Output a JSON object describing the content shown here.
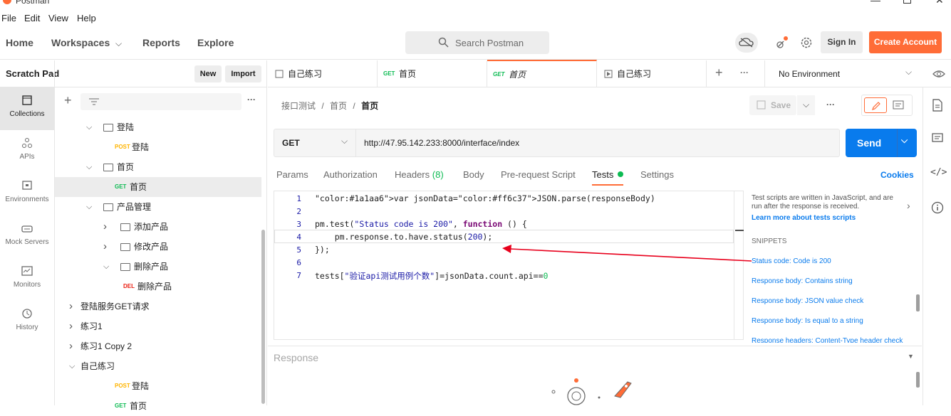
{
  "app": {
    "title": "Postman"
  },
  "menu": [
    "File",
    "Edit",
    "View",
    "Help"
  ],
  "nav": {
    "home": "Home",
    "workspaces": "Workspaces",
    "reports": "Reports",
    "explore": "Explore"
  },
  "search": {
    "placeholder": "Search Postman"
  },
  "account": {
    "signin": "Sign In",
    "create": "Create Account"
  },
  "sidebar": {
    "title": "Scratch Pad",
    "new": "New",
    "import": "Import"
  },
  "leftnav": [
    {
      "label": "Collections",
      "icon": "collections-icon"
    },
    {
      "label": "APIs",
      "icon": "apis-icon"
    },
    {
      "label": "Environments",
      "icon": "environments-icon"
    },
    {
      "label": "Mock Servers",
      "icon": "mock-servers-icon"
    },
    {
      "label": "Monitors",
      "icon": "monitors-icon"
    },
    {
      "label": "History",
      "icon": "history-icon"
    }
  ],
  "tree": [
    {
      "kind": "folder",
      "open": true,
      "label": "登陆",
      "level": 1
    },
    {
      "kind": "request",
      "method": "POST",
      "label": "登陆",
      "level": 2
    },
    {
      "kind": "folder",
      "open": true,
      "label": "首页",
      "level": 1
    },
    {
      "kind": "request",
      "method": "GET",
      "label": "首页",
      "level": 2,
      "selected": true
    },
    {
      "kind": "folder",
      "open": true,
      "label": "产品管理",
      "level": 1
    },
    {
      "kind": "folder",
      "open": false,
      "label": "添加产品",
      "level": 2
    },
    {
      "kind": "folder",
      "open": false,
      "label": "修改产品",
      "level": 2
    },
    {
      "kind": "folder",
      "open": true,
      "label": "删除产品",
      "level": 2
    },
    {
      "kind": "request",
      "method": "DEL",
      "label": "删除产品",
      "level": 3
    },
    {
      "kind": "collection",
      "open": false,
      "label": "登陆服务GET请求",
      "level": 0
    },
    {
      "kind": "collection",
      "open": false,
      "label": "练习1",
      "level": 0
    },
    {
      "kind": "collection",
      "open": false,
      "label": "练习1 Copy 2",
      "level": 0
    },
    {
      "kind": "collection",
      "open": true,
      "label": "自己练习",
      "level": 0
    },
    {
      "kind": "request",
      "method": "POST",
      "label": "登陆",
      "level": 2
    },
    {
      "kind": "request",
      "method": "GET",
      "label": "首页",
      "level": 2
    }
  ],
  "tabs": [
    {
      "label": "自己练习",
      "method": ""
    },
    {
      "label": "首页",
      "method": "GET"
    },
    {
      "label": "首页",
      "method": "GET",
      "active": true
    },
    {
      "label": "自己练习",
      "method": "",
      "runner": true
    }
  ],
  "environment": {
    "label": "No Environment"
  },
  "breadcrumb": {
    "p1": "接口测试",
    "sep": "/",
    "p2": "首页",
    "p3": "首页"
  },
  "toolbar": {
    "save": "Save"
  },
  "request": {
    "method": "GET",
    "url": "http://47.95.142.233:8000/interface/index",
    "send": "Send"
  },
  "reqtabs": {
    "params": "Params",
    "auth": "Authorization",
    "headers": "Headers",
    "headers_count": "(8)",
    "body": "Body",
    "prereq": "Pre-request Script",
    "tests": "Tests",
    "settings": "Settings",
    "cookies": "Cookies"
  },
  "code": [
    "var jsonData=JSON.parse(responseBody)",
    "",
    "pm.test(\"Status code is 200\", function () {",
    "    pm.response.to.have.status(200);",
    "});",
    "",
    "tests[\"验证api测试用例个数\"]=jsonData.count.api==0"
  ],
  "line_numbers": [
    "1",
    "2",
    "3",
    "4",
    "5",
    "6",
    "7"
  ],
  "snippets": {
    "intro": "Test scripts are written in JavaScript, and are run after the response is received.",
    "learn": "Learn more about tests scripts",
    "heading": "SNIPPETS",
    "items": [
      "Status code: Code is 200",
      "Response body: Contains string",
      "Response body: JSON value check",
      "Response body: Is equal to a string",
      "Response headers: Content-Type header check"
    ]
  },
  "response": {
    "label": "Response"
  },
  "colors": {
    "accent": "#ff6c37",
    "send": "#097bed",
    "get": "#0cbb52",
    "post": "#ffb400",
    "del": "#eb2013",
    "annotation": "#e8001c"
  }
}
